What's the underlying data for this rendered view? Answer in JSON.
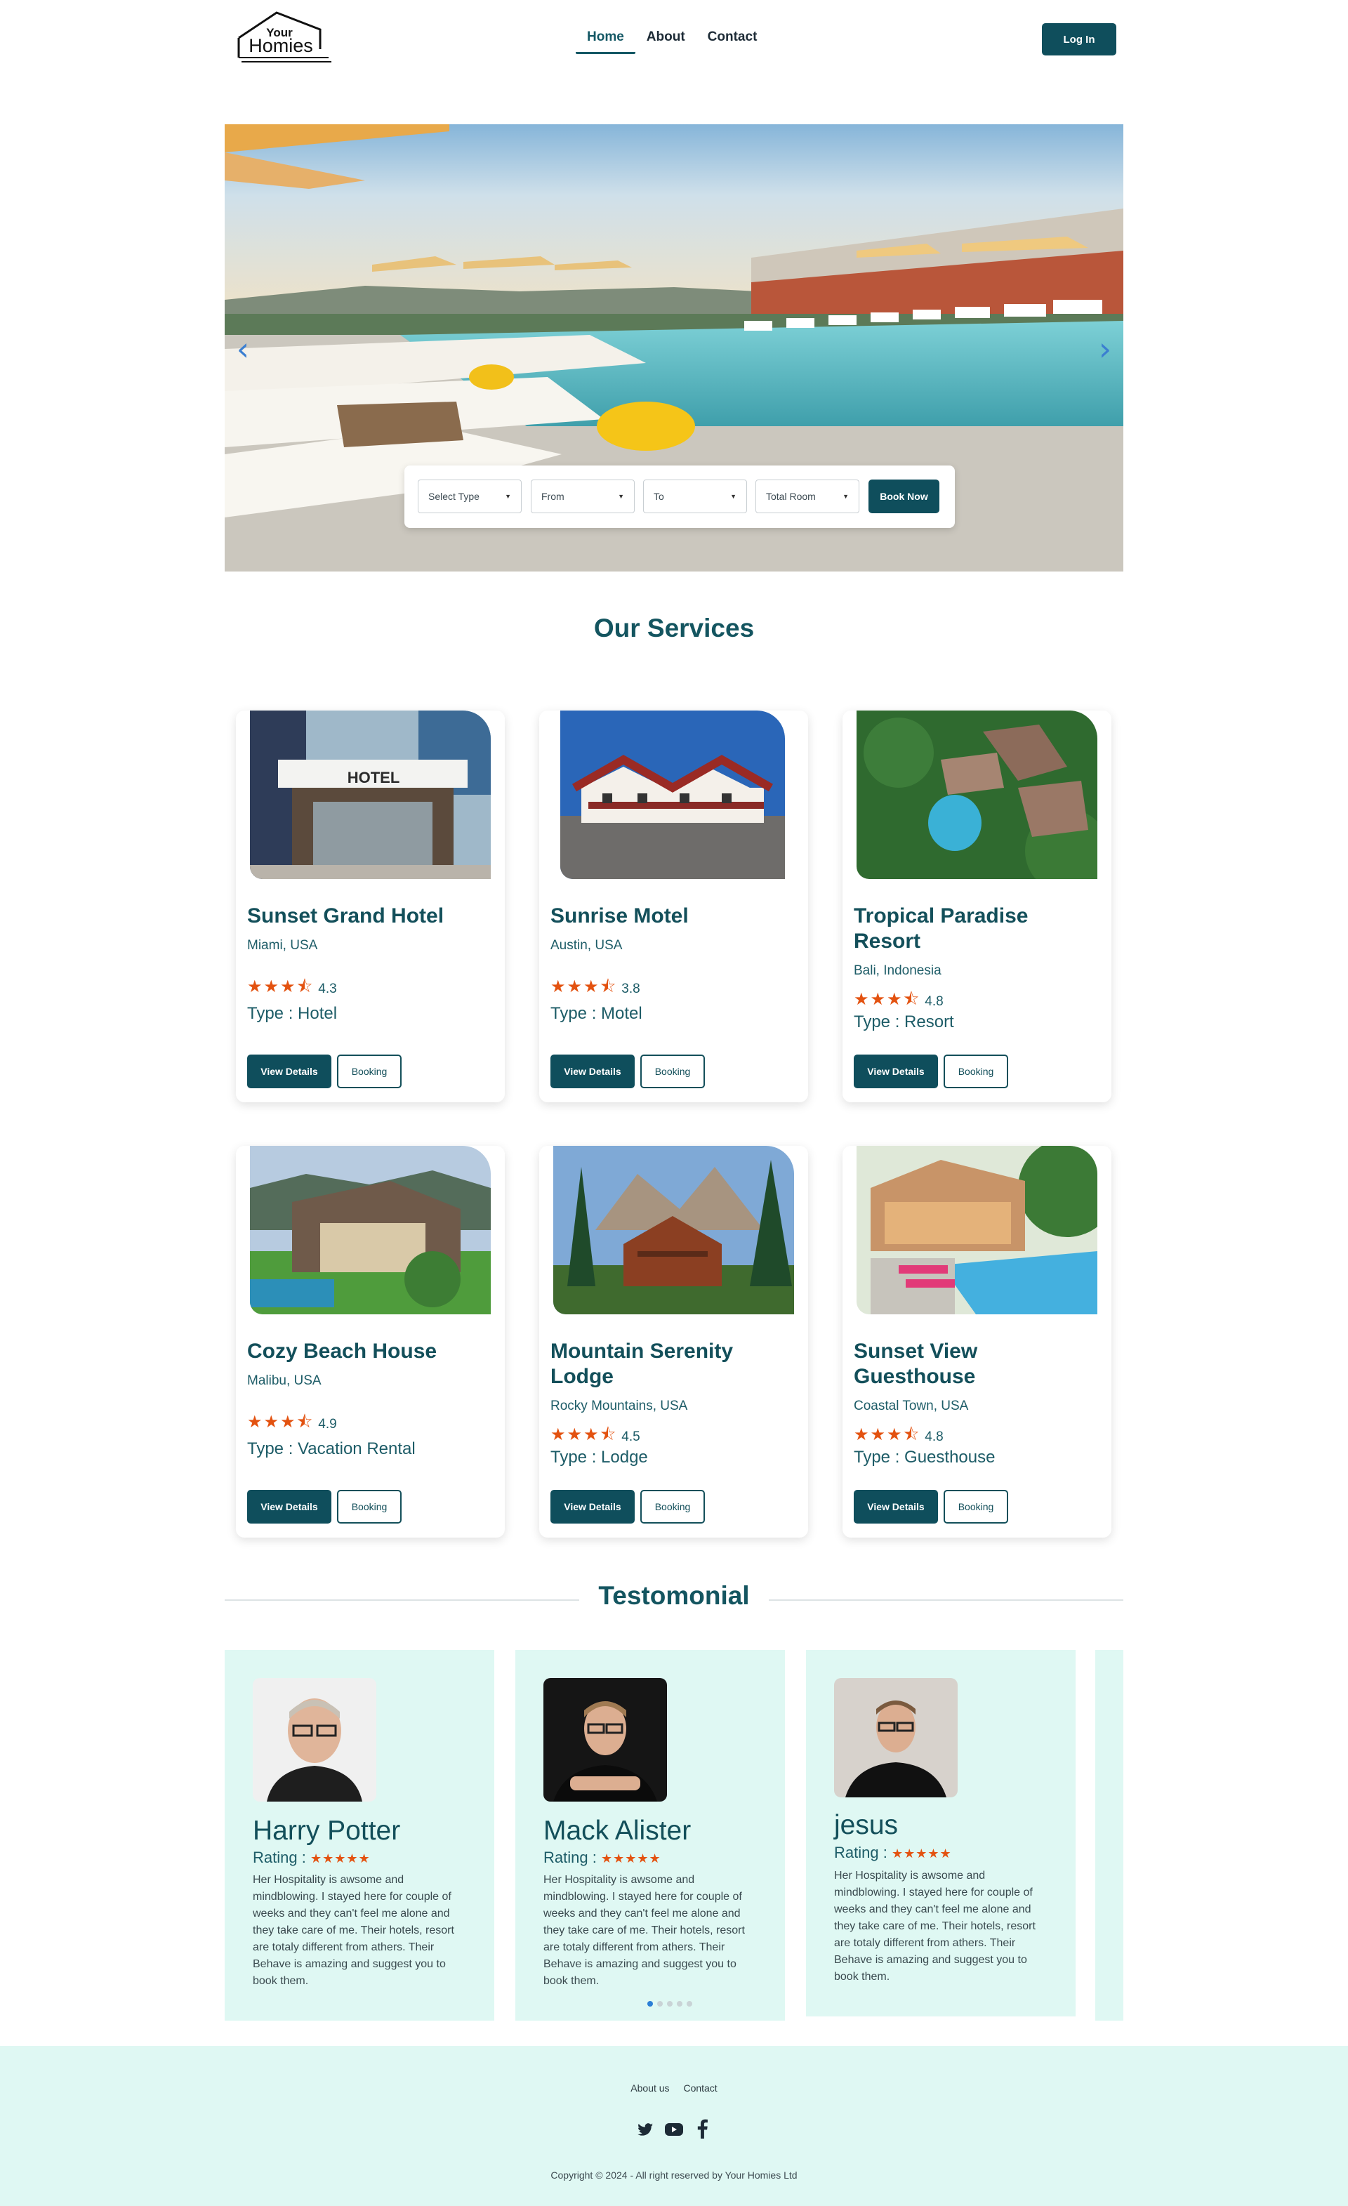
{
  "brand": {
    "logo_line1": "Your",
    "logo_line2": "Homies"
  },
  "nav": {
    "items": [
      {
        "label": "Home"
      },
      {
        "label": "About"
      },
      {
        "label": "Contact"
      }
    ],
    "login": "Log In"
  },
  "search": {
    "type_placeholder": "Select Type",
    "from_placeholder": "From",
    "to_placeholder": "To",
    "rooms_placeholder": "Total Room",
    "submit": "Book Now"
  },
  "services": {
    "title": "Our Services",
    "view_label": "View Details",
    "book_label": "Booking",
    "type_prefix": "Type : ",
    "items": [
      {
        "name": "Sunset Grand Hotel",
        "location": "Miami, USA",
        "rating": "4.3",
        "type": "Type : Hotel",
        "stars": 3.5
      },
      {
        "name": "Sunrise Motel",
        "location": "Austin, USA",
        "rating": "3.8",
        "type": "Type : Motel",
        "stars": 3.5
      },
      {
        "name": "Tropical Paradise Resort",
        "location": "Bali, Indonesia",
        "rating": "4.8",
        "type": "Type : Resort",
        "stars": 3.5
      },
      {
        "name": "Cozy Beach House",
        "location": "Malibu, USA",
        "rating": "4.9",
        "type": "Type : Vacation Rental",
        "stars": 3.5
      },
      {
        "name": "Mountain Serenity Lodge",
        "location": "Rocky Mountains, USA",
        "rating": "4.5",
        "type": "Type : Lodge",
        "stars": 3.5
      },
      {
        "name": "Sunset View Guesthouse",
        "location": "Coastal Town, USA",
        "rating": "4.8",
        "type": "Type : Guesthouse",
        "stars": 3.5
      }
    ]
  },
  "testimonial": {
    "title": "Testomonial",
    "rating_label": "Rating :",
    "items": [
      {
        "name": "Harry Potter",
        "text": "Her Hospitality is awsome and mindblowing. I stayed here for couple of weeks and they can't feel me alone and they take care of me. Their hotels, resort are totaly different from athers. Their Behave is amazing and suggest you to book them.",
        "stars": 5
      },
      {
        "name": "Mack Alister",
        "text": "Her Hospitality is awsome and mindblowing. I stayed here for couple of weeks and they can't feel me alone and they take care of me. Their hotels, resort are totaly different from athers. Their Behave is amazing and suggest you to book them.",
        "stars": 5
      },
      {
        "name": "jesus",
        "text": "Her Hospitality is awsome and mindblowing. I stayed here for couple of weeks and they can't feel me alone and they take care of me. Their hotels, resort are totaly different from athers. Their Behave is amazing and suggest you to book them.",
        "stars": 5
      }
    ],
    "carousel_pages": 5,
    "carousel_active": 1
  },
  "footer": {
    "links": [
      {
        "label": "About us"
      },
      {
        "label": "Contact"
      }
    ],
    "socials": [
      "twitter-icon",
      "youtube-icon",
      "facebook-icon"
    ],
    "copyright": "Copyright © 2024 - All right reserved by Your Homies Ltd"
  },
  "colors": {
    "primary": "#0f4e5c",
    "heading": "#145560",
    "star": "#e35210",
    "mint": "#dff8f3"
  }
}
